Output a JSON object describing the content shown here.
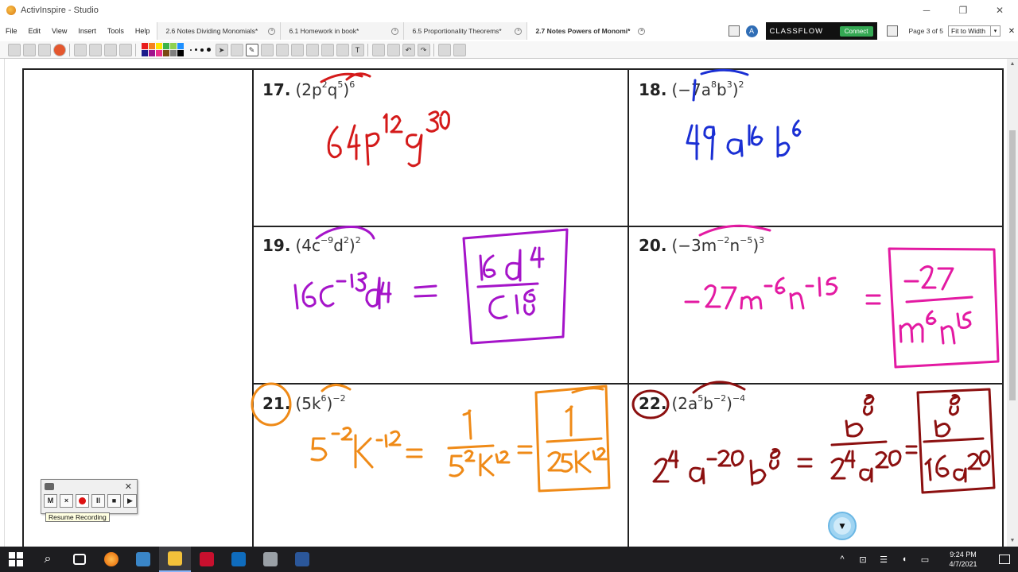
{
  "window": {
    "title": "ActivInspire - Studio",
    "minimize_glyph": "─",
    "restore_glyph": "❐",
    "close_glyph": "✕"
  },
  "menu": [
    "File",
    "Edit",
    "View",
    "Insert",
    "Tools",
    "Help"
  ],
  "tabs": [
    {
      "label": "2.6 Notes Dividing Monomials*",
      "active": false
    },
    {
      "label": "6.1 Homework in book*",
      "active": false
    },
    {
      "label": "6.5 Proportionality Theorems*",
      "active": false
    },
    {
      "label": "2.7 Notes Powers of Monomi*",
      "active": true
    }
  ],
  "tab_close_glyph": "×",
  "classflow": {
    "brand": "CLASSFLOW",
    "connect_label": "Connect"
  },
  "page_indicator": "Page 3 of 5",
  "zoom_select": "Fit to Width",
  "dropdown_glyph": "▾",
  "panel_close_glyph": "✕",
  "toolbar_glyphs": {
    "pointer": "➤",
    "pen": "✎",
    "text": "T",
    "undo": "↶",
    "redo": "↷"
  },
  "palette_colors": [
    "#e81c1c",
    "#f58220",
    "#ffe600",
    "#3cb54a",
    "#8fd14f",
    "#1e90ff",
    "#1c1c8c",
    "#a0138e",
    "#ec2e8c",
    "#7a4a12",
    "#7f7f7f",
    "#000000"
  ],
  "problems": [
    {
      "number": "17.",
      "base": "(2p",
      "e1": "2",
      "mid": "q",
      "e2": "5",
      "close": ")",
      "e3": "6",
      "answer": "64p¹²q³⁰",
      "ink": "#d41a1a"
    },
    {
      "number": "18.",
      "base": "(−7a",
      "e1": "8",
      "mid": "b",
      "e2": "3",
      "close": ")",
      "e3": "2",
      "answer": "49a¹⁶b⁶",
      "ink": "#1a2fd4"
    },
    {
      "number": "19.",
      "base": "(4c",
      "e1": "−9",
      "mid": "d",
      "e2": "2",
      "close": ")",
      "e3": "2",
      "answer": "16c⁻¹⁸d⁴ = 16d⁴ / c¹⁸",
      "ink": "#a514c9"
    },
    {
      "number": "20.",
      "base": "(−3m",
      "e1": "−2",
      "mid": "n",
      "e2": "−5",
      "close": ")",
      "e3": "3",
      "answer": "−27m⁻⁶n⁻¹⁵ = −27 / m⁶n¹⁵",
      "ink": "#e31aa2"
    },
    {
      "number": "21.",
      "base": "(5k",
      "e1": "6",
      "mid": "",
      "e2": "",
      "close": ")",
      "e3": "−2",
      "answer": "5⁻²k⁻¹² = 1/5²k¹² = 1/25k¹²",
      "ink": "#ef8a17"
    },
    {
      "number": "22.",
      "base": "(2a",
      "e1": "5",
      "mid": "b",
      "e2": "−2",
      "close": ")",
      "e3": "−4",
      "answer": "2⁻⁴a⁻²⁰b⁸ = b⁸/2⁴a²⁰ = b⁸/16a²⁰",
      "ink": "#8c1010"
    }
  ],
  "recorder": {
    "buttons": [
      "M",
      "×",
      "●",
      "II",
      "■",
      "▶"
    ],
    "tooltip": "Resume Recording",
    "close_glyph": "✕"
  },
  "scroll_arrows": {
    "up": "▲",
    "down": "▼"
  },
  "taskbar": {
    "search_glyph": "⌕",
    "time": "9:24 PM",
    "date": "4/7/2021",
    "tray_glyphs": [
      "^",
      "⊡",
      "☰",
      "◖",
      "▭"
    ]
  },
  "colors": {
    "ink_red": "#d41a1a",
    "ink_blue": "#1a2fd4",
    "ink_purple": "#a514c9",
    "ink_magenta": "#e31aa2",
    "ink_orange": "#ef8a17",
    "ink_maroon": "#8c1010"
  }
}
